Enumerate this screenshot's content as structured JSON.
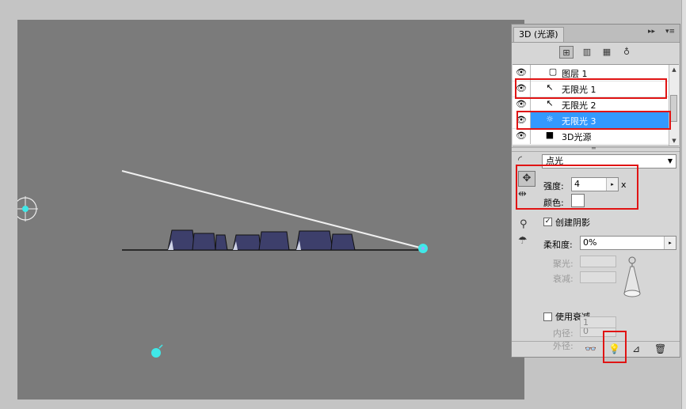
{
  "panel": {
    "title": "3D (光源)",
    "collapse_glyph": "▸▸",
    "menu_glyph": "▾≡",
    "toolbar": [
      {
        "name": "scene-filter-icon",
        "glyph": "⊞",
        "active": true
      },
      {
        "name": "mesh-filter-icon",
        "glyph": "▥",
        "active": false
      },
      {
        "name": "material-filter-icon",
        "glyph": "▦",
        "active": false
      },
      {
        "name": "light-filter-icon",
        "glyph": "♁",
        "active": false
      }
    ]
  },
  "scene_list": [
    {
      "label": "图层 1",
      "icon": "▢",
      "icon_name": "layer-icon",
      "visible_glyph": "👁",
      "selected": false,
      "indent": 1
    },
    {
      "label": "无限光 1",
      "icon": "↖",
      "icon_name": "infinite-light-icon",
      "visible_glyph": "👁",
      "selected": false,
      "indent": 2
    },
    {
      "label": "无限光 2",
      "icon": "↖",
      "icon_name": "infinite-light-icon",
      "visible_glyph": "👁",
      "selected": false,
      "indent": 2
    },
    {
      "label": "无限光 3",
      "icon": "☼",
      "icon_name": "point-light-icon",
      "visible_glyph": "👁",
      "selected": true,
      "indent": 2
    },
    {
      "label": "3D光源",
      "icon": "■",
      "icon_name": "light-group-icon",
      "visible_glyph": "👁",
      "selected": false,
      "indent": 1
    }
  ],
  "properties": {
    "light_type": "点光",
    "intensity_label": "强度:",
    "intensity_value": "4",
    "intensity_suffix": "x",
    "color_label": "颜色:",
    "color_value": "#ffffff",
    "create_shadow_label": "创建阴影",
    "create_shadow_checked": true,
    "softness_label": "柔和度:",
    "softness_value": "0%",
    "hotspot_label": "聚光:",
    "falloff_label": "衰减:",
    "use_attenuation_label": "使用衰减",
    "use_attenuation_checked": false,
    "inner_label": "内径:",
    "inner_value": "0",
    "outer_label": "外径:",
    "outer_value": "1"
  },
  "colors": {
    "canvas_bg": "#7b7b7b",
    "light_marker": "#40e8e8",
    "selection": "#3399ff",
    "highlight_box": "#e01414",
    "keyboard_keys": "#3d3f6b"
  }
}
